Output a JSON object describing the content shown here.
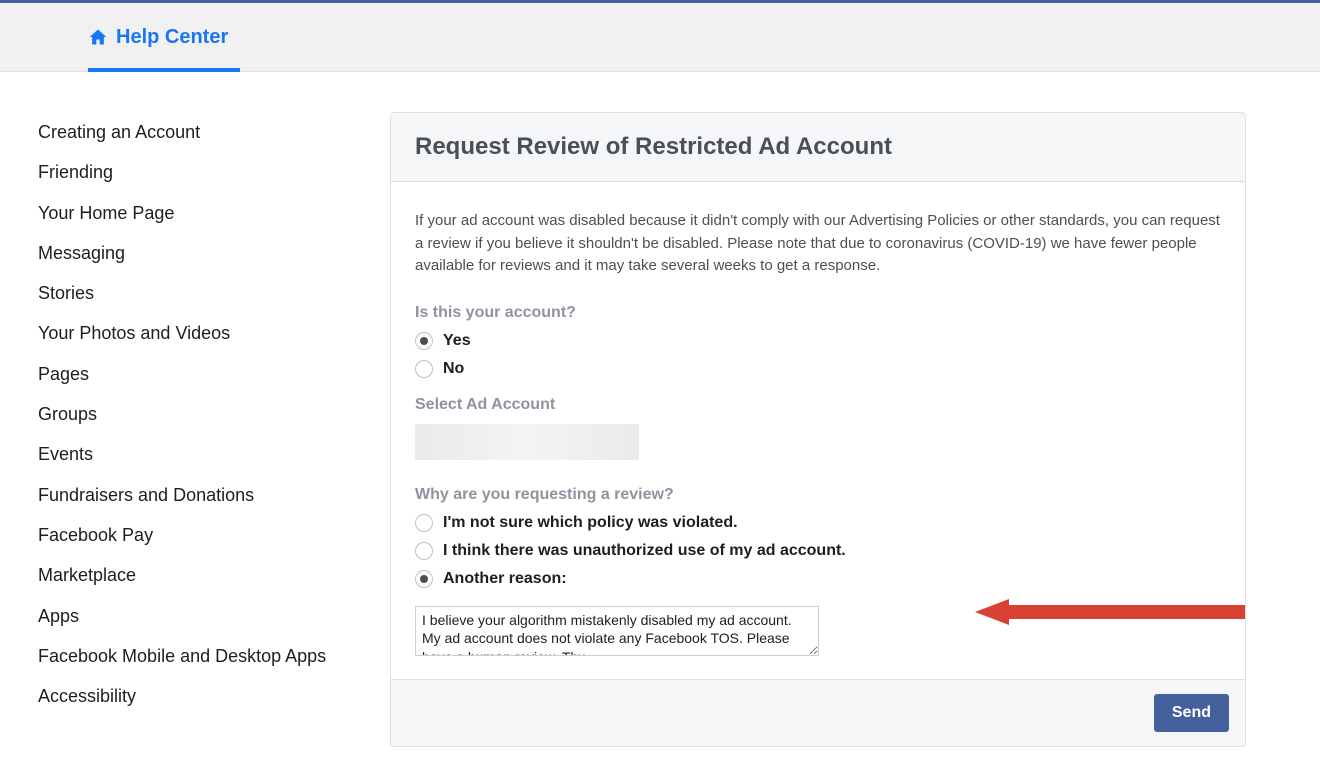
{
  "header": {
    "help_center": "Help Center"
  },
  "sidebar": {
    "items": [
      "Creating an Account",
      "Friending",
      "Your Home Page",
      "Messaging",
      "Stories",
      "Your Photos and Videos",
      "Pages",
      "Groups",
      "Events",
      "Fundraisers and Donations",
      "Facebook Pay",
      "Marketplace",
      "Apps",
      "Facebook Mobile and Desktop Apps",
      "Accessibility"
    ]
  },
  "card": {
    "title": "Request Review of Restricted Ad Account",
    "description": "If your ad account was disabled because it didn't comply with our Advertising Policies or other standards, you can request a review if you believe it shouldn't be disabled. Please note that due to coronavirus (COVID-19) we have fewer people available for reviews and it may take several weeks to get a response.",
    "q1_label": "Is this your account?",
    "q1_yes": "Yes",
    "q1_no": "No",
    "select_label": "Select Ad Account",
    "why_label": "Why are you requesting a review?",
    "why_opts": [
      "I'm not sure which policy was violated.",
      "I think there was unauthorized use of my ad account.",
      "Another reason:"
    ],
    "textarea_value": "I believe your algorithm mistakenly disabled my ad account. My ad account does not violate any Facebook TOS. Please have a human review. Thx",
    "send": "Send"
  }
}
